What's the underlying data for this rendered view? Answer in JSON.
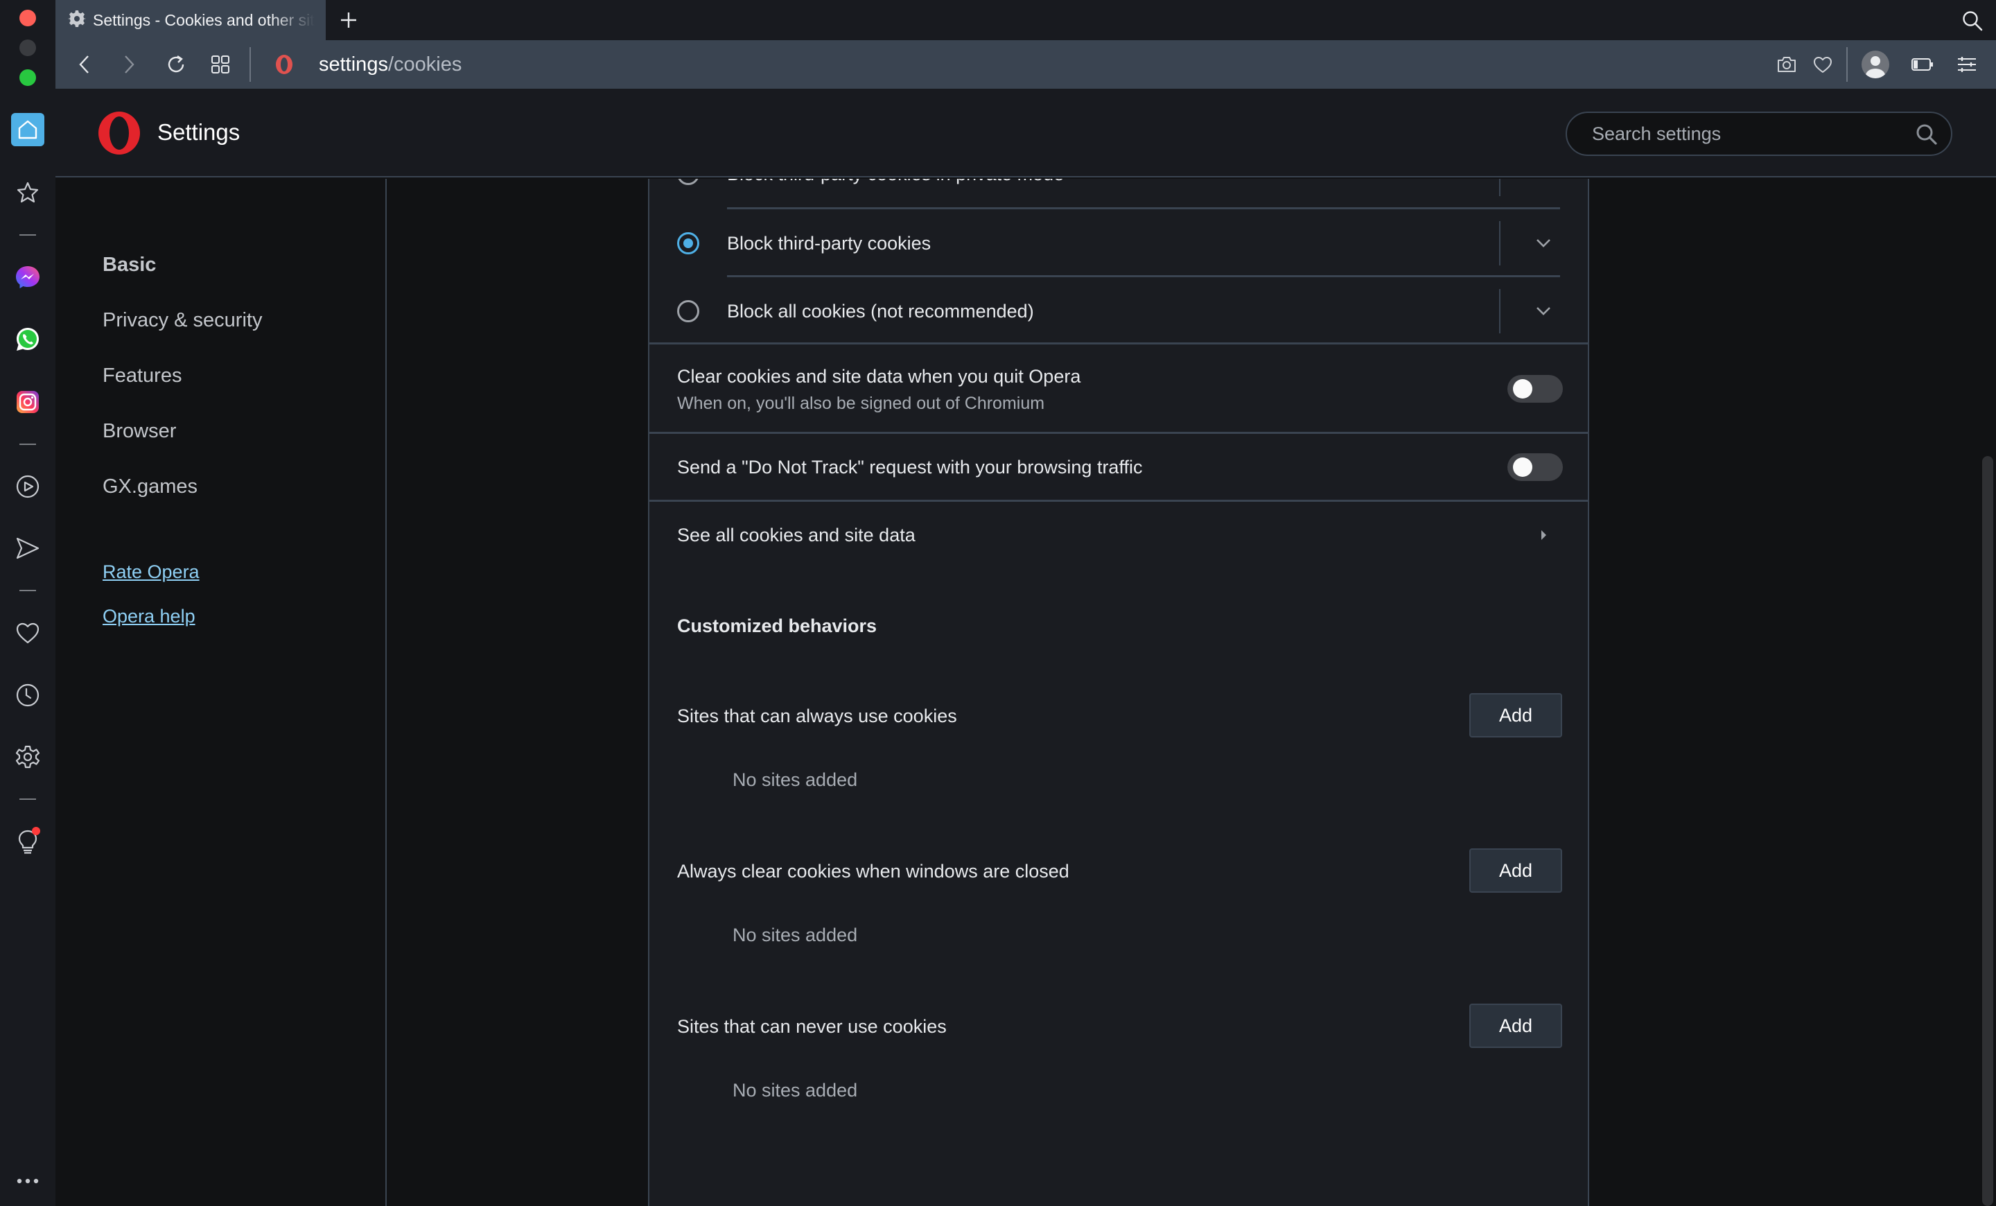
{
  "window": {
    "traffic_lights": [
      "close",
      "minimize",
      "maximize"
    ]
  },
  "tab": {
    "title": "Settings - Cookies and other sit",
    "icon": "gear-icon",
    "new_tab_icon": "plus-icon"
  },
  "address_bar": {
    "host": "settings",
    "path": "/cookies",
    "icons": [
      "back-icon",
      "forward-icon",
      "reload-icon",
      "speed-dial-icon",
      "opera-icon",
      "camera-icon",
      "heart-icon",
      "avatar",
      "battery-icon",
      "easy-setup-icon"
    ]
  },
  "rail": {
    "items": [
      "home",
      "bookmarks",
      "messenger",
      "whatsapp",
      "instagram",
      "player",
      "flow",
      "pinboard",
      "history",
      "settings",
      "tips"
    ],
    "more_icon": "ellipsis-icon"
  },
  "header": {
    "title": "Settings",
    "search_placeholder": "Search settings"
  },
  "nav": {
    "items": [
      {
        "label": "Basic",
        "active": true
      },
      {
        "label": "Privacy & security",
        "active": false
      },
      {
        "label": "Features",
        "active": false
      },
      {
        "label": "Browser",
        "active": false
      },
      {
        "label": "GX.games",
        "active": false
      }
    ],
    "links": [
      {
        "label": "Rate Opera"
      },
      {
        "label": "Opera help"
      }
    ]
  },
  "cookies": {
    "radio_options": [
      {
        "label": "Block third-party cookies in private mode",
        "selected": false
      },
      {
        "label": "Block third-party cookies",
        "selected": true
      },
      {
        "label": "Block all cookies (not recommended)",
        "selected": false
      }
    ],
    "toggles": [
      {
        "label": "Clear cookies and site data when you quit Opera",
        "sublabel": "When on, you'll also be signed out of Chromium",
        "on": false
      },
      {
        "label": "Send a \"Do Not Track\" request with your browsing traffic",
        "on": false
      }
    ],
    "see_all_label": "See all cookies and site data",
    "customized_title": "Customized behaviors",
    "behaviors": [
      {
        "label": "Sites that can always use cookies",
        "button": "Add",
        "empty": "No sites added"
      },
      {
        "label": "Always clear cookies when windows are closed",
        "button": "Add",
        "empty": "No sites added"
      },
      {
        "label": "Sites that can never use cookies",
        "button": "Add",
        "empty": "No sites added"
      }
    ]
  },
  "colors": {
    "accent": "#4fb0e6",
    "link": "#8fd0f5",
    "opera_red": "#e3242b",
    "toolbar": "#3a4451",
    "card": "#1a1c21",
    "page": "#111214"
  }
}
